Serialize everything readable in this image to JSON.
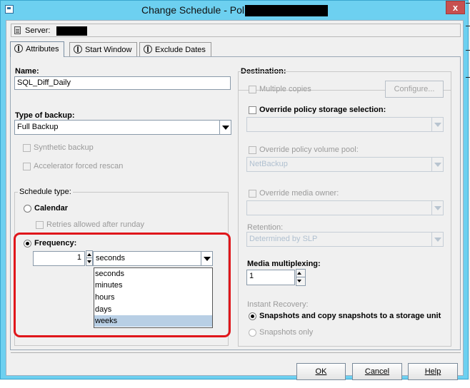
{
  "window": {
    "title": "Change Schedule - Policy",
    "close_label": "x"
  },
  "server": {
    "label": "Server:"
  },
  "tabs": [
    {
      "label": "Attributes"
    },
    {
      "label": "Start Window"
    },
    {
      "label": "Exclude Dates"
    }
  ],
  "attributes": {
    "name_label": "Name:",
    "name_value": "SQL_Diff_Daily",
    "backup_type_label": "Type of backup:",
    "backup_type_value": "Full Backup",
    "synthetic_label": "Synthetic backup",
    "accelerator_label": "Accelerator forced rescan",
    "schedule_type_label": "Schedule type:",
    "calendar_label": "Calendar",
    "retries_label": "Retries allowed after runday",
    "frequency_label": "Frequency:",
    "frequency_value": "1",
    "frequency_unit": "seconds",
    "frequency_options": [
      "seconds",
      "minutes",
      "hours",
      "days",
      "weeks"
    ],
    "frequency_hovered_option": "weeks"
  },
  "destination": {
    "label": "Destination:",
    "multiple_copies_label": "Multiple copies",
    "configure_label": "Configure...",
    "override_storage_label": "Override policy storage selection:",
    "override_volume_label": "Override policy volume pool:",
    "volume_pool_value": "NetBackup",
    "override_media_label": "Override media owner:",
    "retention_label": "Retention:",
    "retention_value": "Determined by SLP",
    "multiplexing_label": "Media multiplexing:",
    "multiplexing_value": "1",
    "instant_recovery_label": "Instant Recovery:",
    "snapshots_copy_label": "Snapshots and copy snapshots to a storage unit",
    "snapshots_only_label": "Snapshots only"
  },
  "buttons": {
    "ok": "OK",
    "cancel": "Cancel",
    "help": "Help"
  },
  "colors": {
    "titlebar": "#6dd0f0",
    "close_button": "#c75050",
    "highlight_border": "#e0161b",
    "dropdown_hover": "#b8cfe5"
  }
}
